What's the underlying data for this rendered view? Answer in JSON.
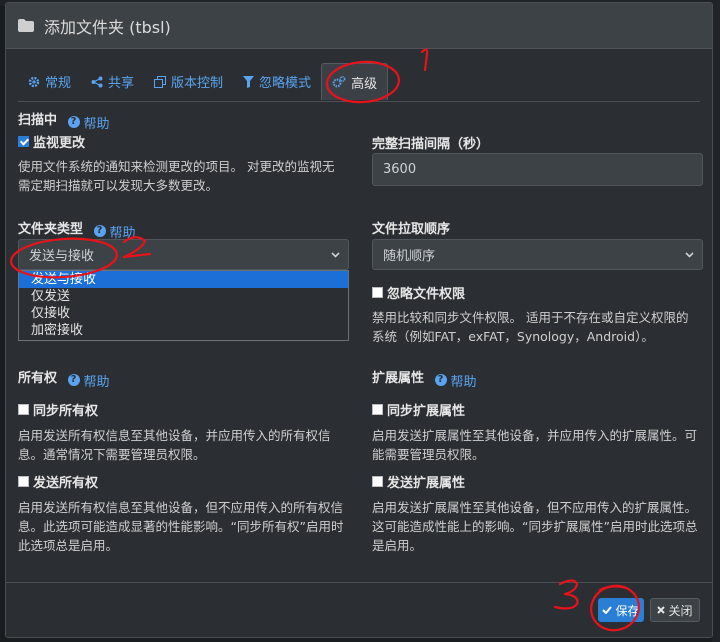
{
  "modal": {
    "title": "添加文件夹 (tbsl)"
  },
  "tabs": [
    {
      "label": "常规",
      "icon": "gear-icon"
    },
    {
      "label": "共享",
      "icon": "share-icon"
    },
    {
      "label": "版本控制",
      "icon": "copy-icon"
    },
    {
      "label": "忽略模式",
      "icon": "filter-icon"
    },
    {
      "label": "高级",
      "icon": "cogs-icon",
      "active": true
    }
  ],
  "scanning": {
    "heading": "扫描中",
    "help": "帮助",
    "watch_label": "监视更改",
    "watch_checked": true,
    "watch_desc_1": "使用文件系统的通知来检测更改的项目。 对更改的监视无",
    "watch_desc_2": "需定期扫描就可以发现大多数更改。",
    "rescan_label": "完整扫描间隔（秒）",
    "rescan_value": "3600"
  },
  "folder_type": {
    "label": "文件夹类型",
    "help": "帮助",
    "selected": "发送与接收",
    "options": [
      "发送与接收",
      "仅发送",
      "仅接收",
      "加密接收"
    ]
  },
  "pull_order": {
    "label": "文件拉取顺序",
    "selected": "随机顺序"
  },
  "ignore_perms": {
    "label": "忽略文件权限",
    "checked": false,
    "desc_1": "禁用比较和同步文件权限。 适用于不存在或自定义权限的",
    "desc_2": "系统（例如FAT，exFAT，Synology，Android）。"
  },
  "ownership": {
    "heading": "所有权",
    "help": "帮助",
    "sync_label": "同步所有权",
    "sync_desc_1": "启用发送所有权信息至其他设备，并应用传入的所有权信",
    "sync_desc_2": "息。通常情况下需要管理员权限。",
    "send_label": "发送所有权",
    "send_desc_1": "启用发送所有权信息至其他设备，但不应用传入的所有权信",
    "send_desc_2": "息。此选项可能造成显著的性能影响。“同步所有权”启用时",
    "send_desc_3": "此选项总是启用。"
  },
  "xattrs": {
    "heading": "扩展属性",
    "help": "帮助",
    "sync_label": "同步扩展属性",
    "sync_desc_1": "启用发送扩展属性至其他设备，并应用传入的扩展属性。可",
    "sync_desc_2": "能需要管理员权限。",
    "send_label": "发送扩展属性",
    "send_desc_1": "启用发送扩展属性至其他设备，但不应用传入的扩展属性。",
    "send_desc_2": "这可能造成性能上的影响。“同步扩展属性”启用时此选项总",
    "send_desc_3": "是启用。"
  },
  "footer": {
    "save_label": "保存",
    "close_label": "关闭"
  },
  "annotations": [
    "1",
    "2",
    "3"
  ],
  "colors": {
    "accent": "#2a7fd4",
    "link": "#5aa3f0",
    "annotation": "#e8121a"
  }
}
